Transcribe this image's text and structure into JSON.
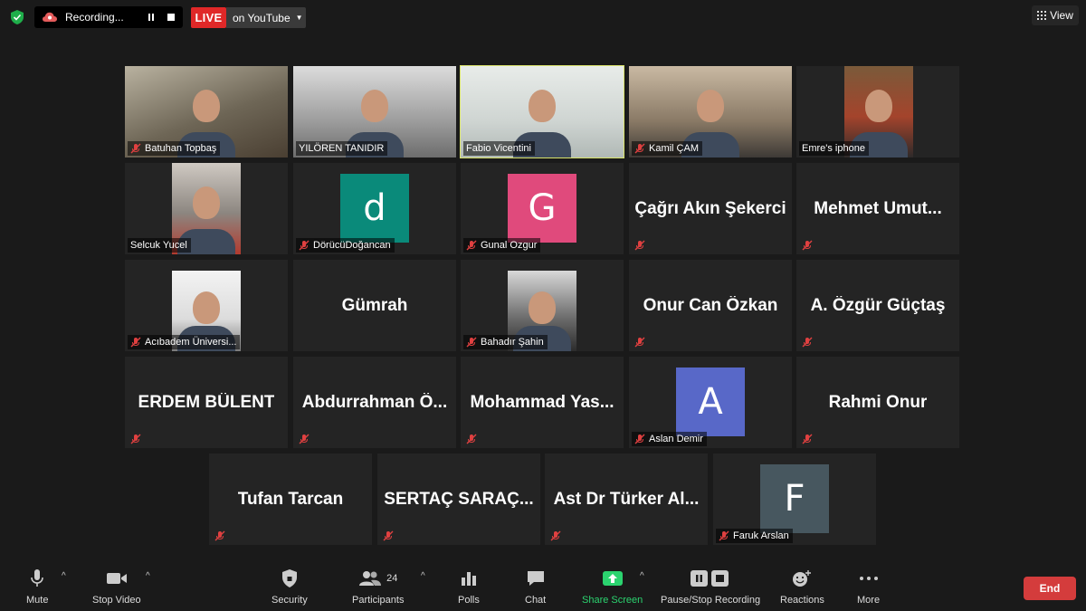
{
  "topbar": {
    "recording_label": "Recording...",
    "live_label": "LIVE",
    "live_destination": "on YouTube",
    "view_label": "View"
  },
  "colors": {
    "background": "#1a1a1a",
    "tile": "#242424",
    "active_speaker": "#d8e26a",
    "live_red": "#e02828",
    "share_green": "#2bd36f",
    "end_red": "#d43c3c",
    "avatar_d": "#0a8a7a",
    "avatar_g": "#e04a7c",
    "avatar_a": "#5868c8",
    "avatar_f": "#47575f"
  },
  "participants": [
    {
      "name": "Batuhan Topbaş",
      "type": "video",
      "muted": true
    },
    {
      "name": "YILÖREN TANIDIR",
      "type": "video",
      "muted": false
    },
    {
      "name": "Fabio Vicentini",
      "type": "video",
      "muted": false,
      "active": true
    },
    {
      "name": "Kamil ÇAM",
      "type": "video",
      "muted": true
    },
    {
      "name": "Emre's iphone",
      "type": "video",
      "muted": false
    },
    {
      "name": "Selcuk Yucel",
      "type": "video",
      "muted": false
    },
    {
      "name": "DörücüDoğancan",
      "type": "avatar",
      "letter": "d",
      "muted": true
    },
    {
      "name": "Gunal Ozgur",
      "type": "avatar",
      "letter": "G",
      "muted": true
    },
    {
      "name": "Çağrı Akın Şekerci",
      "type": "name",
      "muted": true
    },
    {
      "name": "Mehmet  Umut...",
      "type": "name",
      "muted": true
    },
    {
      "name": "Acıbadem Üniversi...",
      "type": "video",
      "muted": true
    },
    {
      "name": "Gümrah",
      "type": "name",
      "muted": false
    },
    {
      "name": "Bahadır Şahin",
      "type": "video",
      "muted": true
    },
    {
      "name": "Onur Can Özkan",
      "type": "name",
      "muted": true
    },
    {
      "name": "A. Özgür Güçtaş",
      "type": "name",
      "muted": true
    },
    {
      "name": "ERDEM BÜLENT",
      "type": "name",
      "muted": true
    },
    {
      "name": "Abdurrahman  Ö...",
      "type": "name",
      "muted": true
    },
    {
      "name": "Mohammad  Yas...",
      "type": "name",
      "muted": true
    },
    {
      "name": "Aslan Demir",
      "type": "avatar",
      "letter": "A",
      "muted": true
    },
    {
      "name": "Rahmi Onur",
      "type": "name",
      "muted": true
    },
    {
      "name": "Tufan Tarcan",
      "type": "name",
      "muted": true
    },
    {
      "name": "SERTAÇ  SARAÇ...",
      "type": "name",
      "muted": true
    },
    {
      "name": "Ast Dr Türker Al...",
      "type": "name",
      "muted": true
    },
    {
      "name": "Faruk Arslan",
      "type": "avatar",
      "letter": "F",
      "muted": true
    }
  ],
  "toolbar": {
    "mute": "Mute",
    "stop_video": "Stop Video",
    "security": "Security",
    "participants": "Participants",
    "participants_count": "24",
    "polls": "Polls",
    "chat": "Chat",
    "share_screen": "Share Screen",
    "pause_stop_recording": "Pause/Stop Recording",
    "reactions": "Reactions",
    "more": "More",
    "end": "End"
  }
}
